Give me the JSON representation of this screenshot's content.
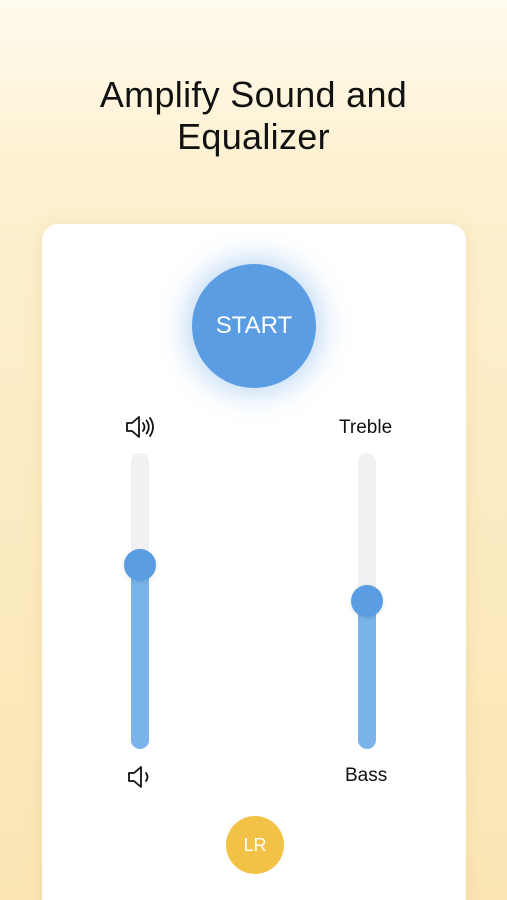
{
  "header": {
    "title_line1": "Amplify Sound and",
    "title_line2": "Equalizer"
  },
  "controls": {
    "start_label": "START",
    "lr_label": "LR",
    "volume_up_icon": "speaker-loud-icon",
    "volume_down_icon": "speaker-quiet-icon"
  },
  "sliders": {
    "volume": {
      "level": 0.62
    },
    "equalizer": {
      "top_label": "Treble",
      "bottom_label": "Bass",
      "level": 0.5
    }
  },
  "colors": {
    "accent_blue": "#5b9de3",
    "fill_blue": "#7ab4ea",
    "lr_yellow": "#f2c247"
  }
}
